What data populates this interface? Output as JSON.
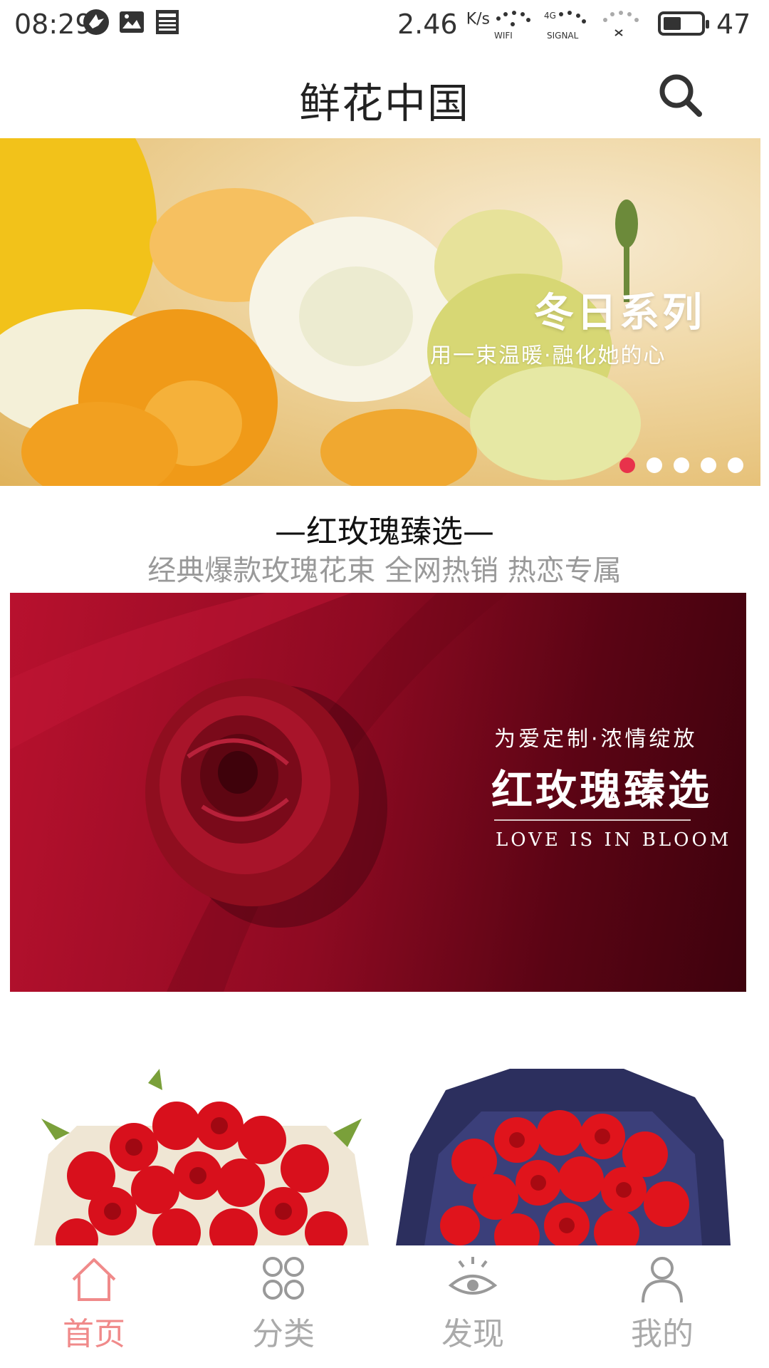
{
  "status_bar": {
    "time": "08:29",
    "speed": "2.46",
    "speed_unit": "K/s",
    "wifi_label": "WIFI",
    "signal_label": "SIGNAL",
    "signal_tag": "4G",
    "battery": "47",
    "battery_level": 0.47
  },
  "header": {
    "title": "鲜花中国"
  },
  "banner": {
    "title": "冬日系列",
    "subtitle": "用一束温暖·融化她的心",
    "dot_count": 5,
    "active_dot": 0
  },
  "section": {
    "title": "—红玫瑰臻选—",
    "subtitle": "经典爆款玫瑰花束 全网热销 热恋专属"
  },
  "rose_banner": {
    "tagline": "为爱定制·浓情绽放",
    "headline": "红玫瑰臻选",
    "english": "LOVE IS IN BLOOM"
  },
  "bottom_nav": {
    "items": [
      {
        "label": "首页",
        "icon": "home-icon",
        "active": true
      },
      {
        "label": "分类",
        "icon": "category-icon",
        "active": false
      },
      {
        "label": "发现",
        "icon": "eye-icon",
        "active": false
      },
      {
        "label": "我的",
        "icon": "person-icon",
        "active": false
      }
    ]
  },
  "colors": {
    "accent": "#e8324b",
    "nav_active": "#f08a8a",
    "nav_inactive": "#aaaaaa"
  }
}
